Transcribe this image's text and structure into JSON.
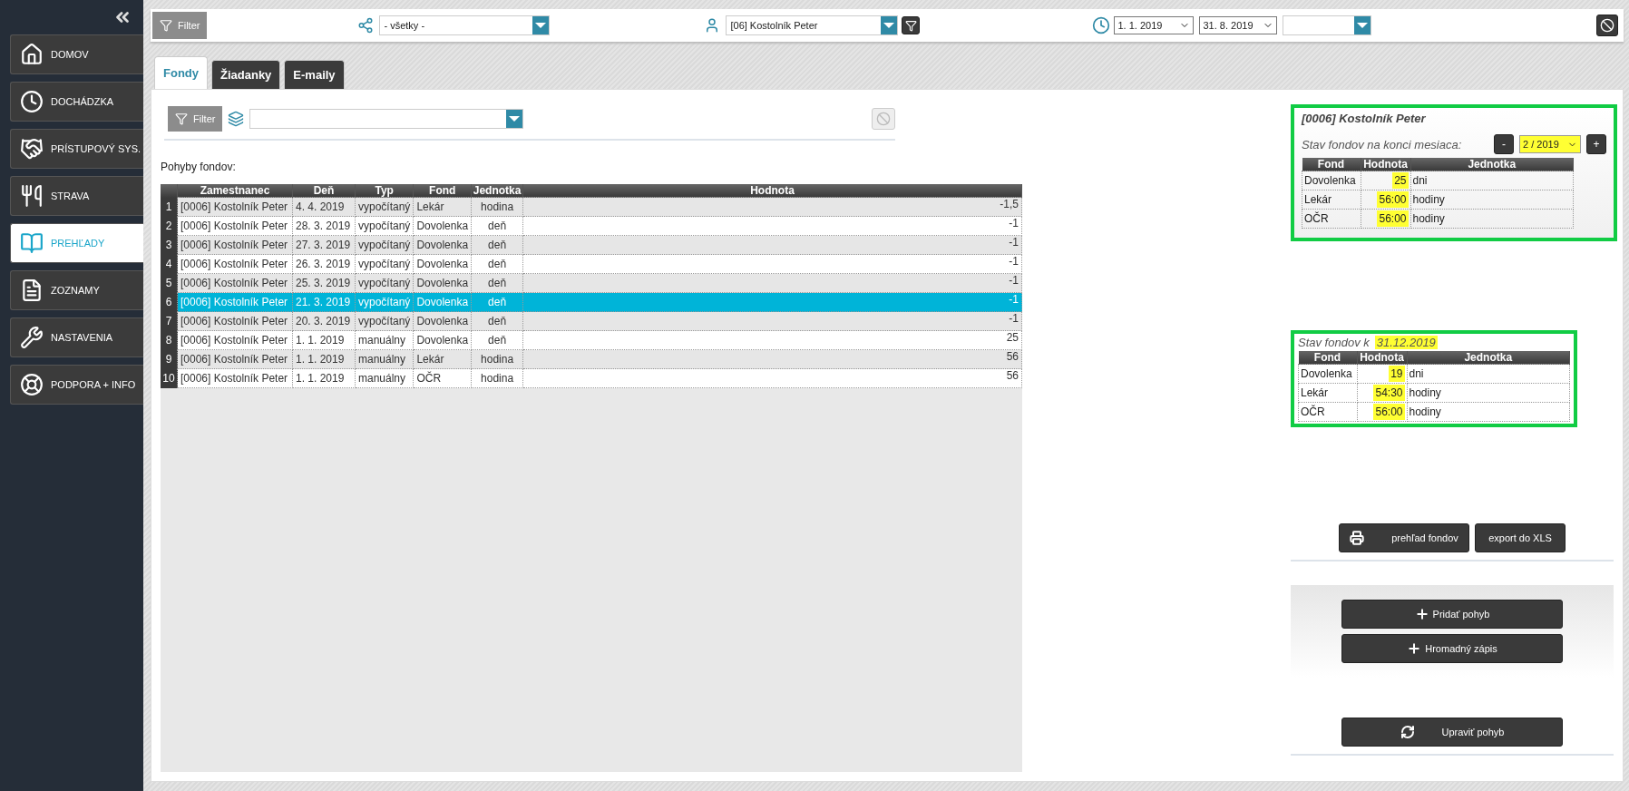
{
  "sidebar": {
    "items": [
      {
        "kind": "home",
        "label": "DOMOV",
        "selected": false
      },
      {
        "kind": "clock",
        "label": "DOCHÁDZKA",
        "selected": false
      },
      {
        "kind": "access",
        "label": "PRÍSTUPOVÝ SYS.",
        "selected": false
      },
      {
        "kind": "food",
        "label": "STRAVA",
        "selected": false
      },
      {
        "kind": "overview",
        "label": "PREHĽADY",
        "selected": true
      },
      {
        "kind": "list",
        "label": "ZOZNAMY",
        "selected": false
      },
      {
        "kind": "settings",
        "label": "NASTAVENIA",
        "selected": false
      },
      {
        "kind": "support",
        "label": "PODPORA + INFO",
        "selected": false
      }
    ]
  },
  "top_bar": {
    "filter_label": "Filter",
    "group_select": "- všetky -",
    "employee_select": "[06] Kostolník Peter",
    "date_from": "1. 1. 2019",
    "date_to": "31. 8. 2019"
  },
  "tabs": [
    {
      "label": "Fondy",
      "selected": true
    },
    {
      "label": "Žiadanky",
      "selected": false
    },
    {
      "label": "E-maily",
      "selected": false
    }
  ],
  "left": {
    "filter_label": "Filter",
    "section_title": "Pohyby fondov:",
    "table": {
      "columns": [
        "Zamestnanec",
        "Deň",
        "Typ",
        "Fond",
        "Jednotka",
        "Hodnota"
      ],
      "rows": [
        {
          "index": "1",
          "cells": [
            "[0006] Kostolník Peter",
            "4. 4. 2019",
            "vypočítaný",
            "Lekár",
            "hodina",
            "-1,5"
          ],
          "selected": false
        },
        {
          "index": "2",
          "cells": [
            "[0006] Kostolník Peter",
            "28. 3. 2019",
            "vypočítaný",
            "Dovolenka",
            "deň",
            "-1"
          ],
          "selected": false
        },
        {
          "index": "3",
          "cells": [
            "[0006] Kostolník Peter",
            "27. 3. 2019",
            "vypočítaný",
            "Dovolenka",
            "deň",
            "-1"
          ],
          "selected": false
        },
        {
          "index": "4",
          "cells": [
            "[0006] Kostolník Peter",
            "26. 3. 2019",
            "vypočítaný",
            "Dovolenka",
            "deň",
            "-1"
          ],
          "selected": false
        },
        {
          "index": "5",
          "cells": [
            "[0006] Kostolník Peter",
            "25. 3. 2019",
            "vypočítaný",
            "Dovolenka",
            "deň",
            "-1"
          ],
          "selected": false
        },
        {
          "index": "6",
          "cells": [
            "[0006] Kostolník Peter",
            "21. 3. 2019",
            "vypočítaný",
            "Dovolenka",
            "deň",
            "-1"
          ],
          "selected": true
        },
        {
          "index": "7",
          "cells": [
            "[0006] Kostolník Peter",
            "20. 3. 2019",
            "vypočítaný",
            "Dovolenka",
            "deň",
            "-1"
          ],
          "selected": false
        },
        {
          "index": "8",
          "cells": [
            "[0006] Kostolník Peter",
            "1. 1. 2019",
            "manuálny",
            "Dovolenka",
            "deň",
            "25"
          ],
          "selected": false
        },
        {
          "index": "9",
          "cells": [
            "[0006] Kostolník Peter",
            "1. 1. 2019",
            "manuálny",
            "Lekár",
            "hodina",
            "56"
          ],
          "selected": false
        },
        {
          "index": "10",
          "cells": [
            "[0006] Kostolník Peter",
            "1. 1. 2019",
            "manuálny",
            "OČR",
            "hodina",
            "56"
          ],
          "selected": false
        }
      ]
    }
  },
  "right": {
    "month_summary": {
      "title": "[0006] Kostolník Peter",
      "label": "Stav fondov na konci mesiaca:",
      "prev": "-",
      "month": "2 / 2019",
      "next": "+",
      "columns": [
        "Fond",
        "Hodnota",
        "Jednotka"
      ],
      "rows": [
        [
          "Dovolenka",
          "25",
          "dni"
        ],
        [
          "Lekár",
          "56:00",
          "hodiny"
        ],
        [
          "OČR",
          "56:00",
          "hodiny"
        ]
      ]
    },
    "year_summary": {
      "label": "Stav fondov k",
      "date": "31.12.2019",
      "columns": [
        "Fond",
        "Hodnota",
        "Jednotka"
      ],
      "rows": [
        [
          "Dovolenka",
          "19",
          "dni"
        ],
        [
          "Lekár",
          "54:30",
          "hodiny"
        ],
        [
          "OČR",
          "56:00",
          "hodiny"
        ]
      ]
    },
    "buttons": [
      {
        "kind": "print",
        "label": "prehľad fondov"
      },
      {
        "kind": "plain",
        "label": "export do XLS"
      }
    ],
    "add_buttons": [
      {
        "kind": "add",
        "label": "Pridať pohyb"
      },
      {
        "kind": "add",
        "label": "Hromadný zápis"
      }
    ],
    "edit_buttons": [
      {
        "kind": "refresh",
        "label": "Upraviť pohyb"
      }
    ]
  }
}
